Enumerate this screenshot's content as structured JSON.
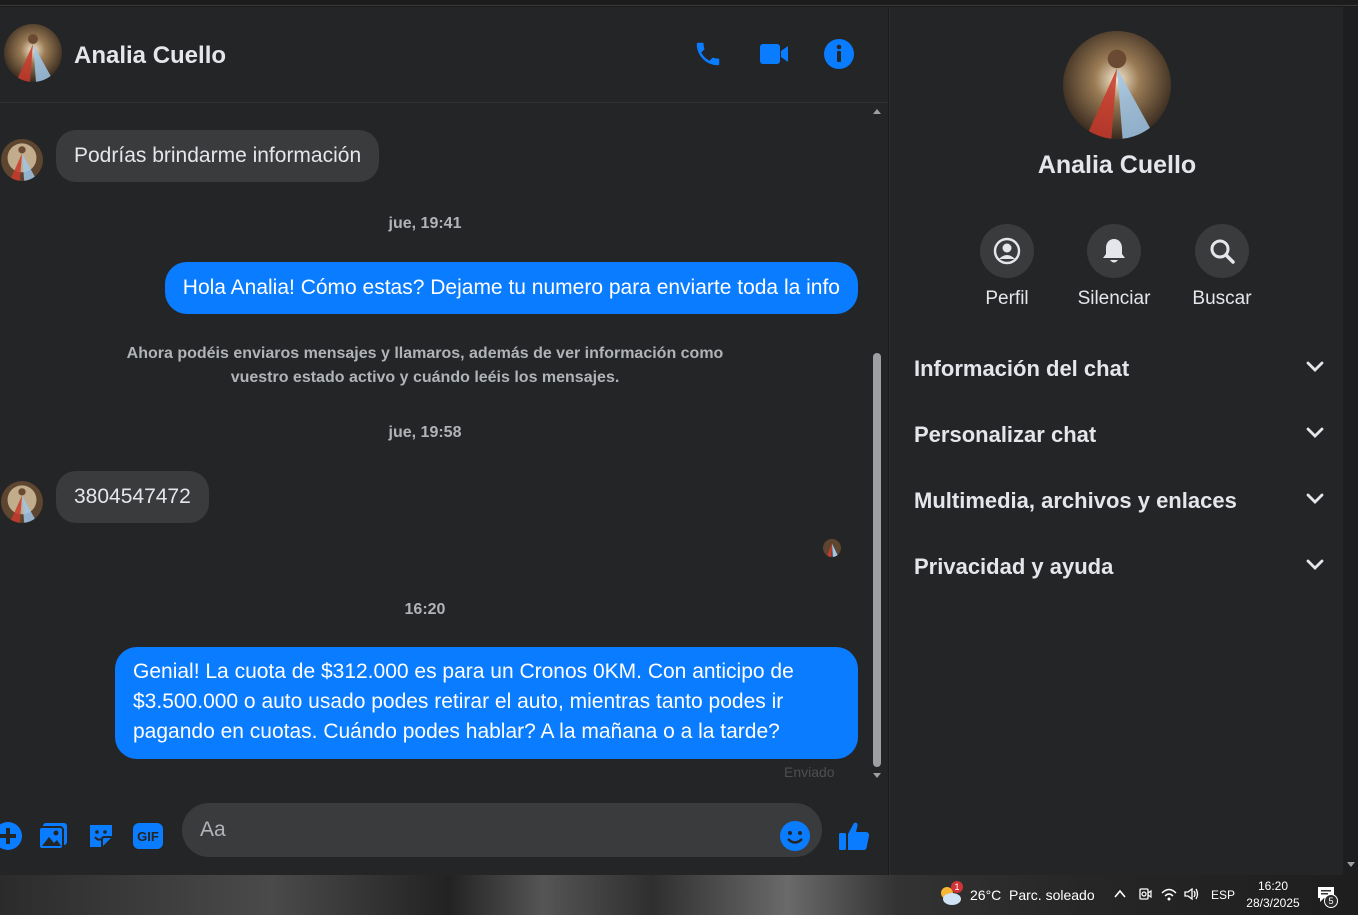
{
  "contact": {
    "name": "Analia Cuello"
  },
  "header_icons": [
    "phone-icon",
    "video-camera-icon",
    "info-icon"
  ],
  "messages": {
    "m1": "Podrías brindarme información",
    "ts1": "jue, 19:41",
    "m2": "Hola Analia! Cómo estas? Dejame tu numero para enviarte toda la info",
    "system_line1": "Ahora podéis enviaros mensajes y llamaros, además de ver información como",
    "system_line2": "vuestro estado activo y cuándo leéis los mensajes.",
    "ts2": "jue, 19:58",
    "m3": "3804547472",
    "ts3": "16:20",
    "m4_line1": "Genial! La cuota de $312.000 es para un Cronos 0KM. Con anticipo de",
    "m4_line2": "$3.500.000 o auto usado podes retirar el auto, mientras tanto podes ir",
    "m4_line3": "pagando en cuotas. Cuándo podes hablar? A la mañana o a la tarde?",
    "sent_status": "Enviado"
  },
  "composer": {
    "placeholder": "Aa",
    "icons": [
      "plus-icon",
      "gallery-icon",
      "sticker-icon",
      "gif-icon",
      "emoji-icon",
      "thumbs-up-icon"
    ],
    "gif_text": "GIF"
  },
  "panel": {
    "name": "Analia Cuello",
    "actions": {
      "profile": "Perfil",
      "mute": "Silenciar",
      "search": "Buscar"
    },
    "sections": {
      "chat_info": "Información del chat",
      "customize": "Personalizar chat",
      "media": "Multimedia, archivos y enlaces",
      "privacy": "Privacidad y ayuda"
    }
  },
  "taskbar": {
    "weather_temp": "26°C",
    "weather_desc": "Parc. soleado",
    "weather_badge": "1",
    "language": "ESP",
    "time": "16:20",
    "date": "28/3/2025",
    "notifications": "5"
  },
  "colors": {
    "accent": "#0a7cff",
    "background": "#242526",
    "bubble_in": "#3a3b3c"
  }
}
